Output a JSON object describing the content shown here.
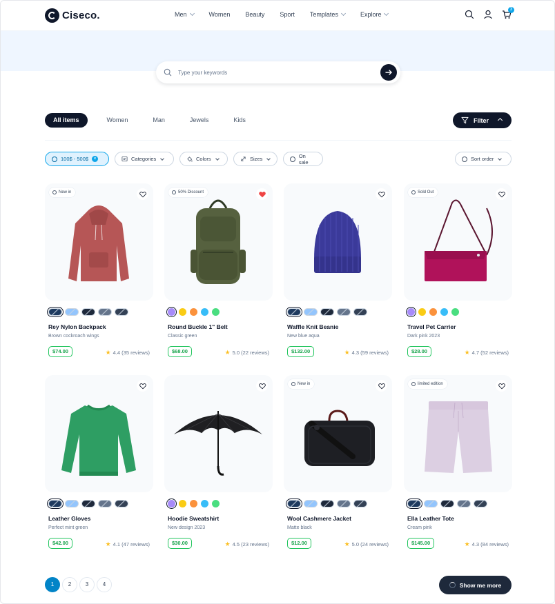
{
  "brand": "Ciseco.",
  "nav": [
    {
      "label": "Men",
      "dropdown": true
    },
    {
      "label": "Women",
      "dropdown": false
    },
    {
      "label": "Beauty",
      "dropdown": false
    },
    {
      "label": "Sport",
      "dropdown": false
    },
    {
      "label": "Templates",
      "dropdown": true
    },
    {
      "label": "Explore",
      "dropdown": true
    }
  ],
  "header": {
    "cart_count": "3"
  },
  "search": {
    "placeholder": "Type your keywords",
    "value": ""
  },
  "tabs": [
    "All items",
    "Women",
    "Man",
    "Jewels",
    "Kids"
  ],
  "filter_label": "Filter",
  "chips": {
    "price": "100$ - 500$",
    "categories": "Categories",
    "colors": "Colors",
    "sizes": "Sizes",
    "on_sale": "On sale",
    "sort": "Sort order"
  },
  "products": [
    {
      "name": "Rey Nylon Backpack",
      "sub": "Brown cockroach wings",
      "price": "$74.00",
      "rating": "4.4 (35 reviews)",
      "badge": "New in",
      "liked": false,
      "swatch": "image",
      "image": "hoodie-red"
    },
    {
      "name": "Round Buckle 1\" Belt",
      "sub": "Classic green",
      "price": "$68.00",
      "rating": "5.0 (22 reviews)",
      "badge": "50% Discount",
      "liked": true,
      "swatch": "color",
      "image": "backpack-green"
    },
    {
      "name": "Waffle Knit Beanie",
      "sub": "New blue aqua",
      "price": "$132.00",
      "rating": "4.3 (59 reviews)",
      "badge": "",
      "liked": false,
      "swatch": "image",
      "image": "beanie-blue"
    },
    {
      "name": "Travel Pet Carrier",
      "sub": "Dark pink 2023",
      "price": "$28.00",
      "rating": "4.7 (52 reviews)",
      "badge": "Sold Out",
      "liked": false,
      "swatch": "color",
      "image": "bag-pink"
    },
    {
      "name": "Leather Gloves",
      "sub": "Perfect mint green",
      "price": "$42.00",
      "rating": "4.1 (47 reviews)",
      "badge": "",
      "liked": false,
      "swatch": "image",
      "image": "sweater-green"
    },
    {
      "name": "Hoodie Sweatshirt",
      "sub": "New design 2023",
      "price": "$30.00",
      "rating": "4.5 (23 reviews)",
      "badge": "",
      "liked": false,
      "swatch": "color",
      "image": "umbrella-black"
    },
    {
      "name": "Wool Cashmere Jacket",
      "sub": "Matte black",
      "price": "$12.00",
      "rating": "5.0 (24 reviews)",
      "badge": "New in",
      "liked": false,
      "swatch": "image",
      "image": "duffel-black"
    },
    {
      "name": "Ella Leather Tote",
      "sub": "Cream pink",
      "price": "$145.00",
      "rating": "4.3 (84 reviews)",
      "badge": "limited edition",
      "liked": false,
      "swatch": "image",
      "image": "shorts-lilac"
    }
  ],
  "color_swatches": [
    "#a78bfa",
    "#facc15",
    "#fb923c",
    "#38bdf8",
    "#4ade80"
  ],
  "pagination": [
    "1",
    "2",
    "3",
    "4"
  ],
  "show_more": "Show me more",
  "colors": {
    "accent": "#0ea5e9",
    "dark": "#0f172a",
    "price_green": "#22c55e",
    "hero_bg": "#eff6ff",
    "heart_red": "#ef4444"
  }
}
